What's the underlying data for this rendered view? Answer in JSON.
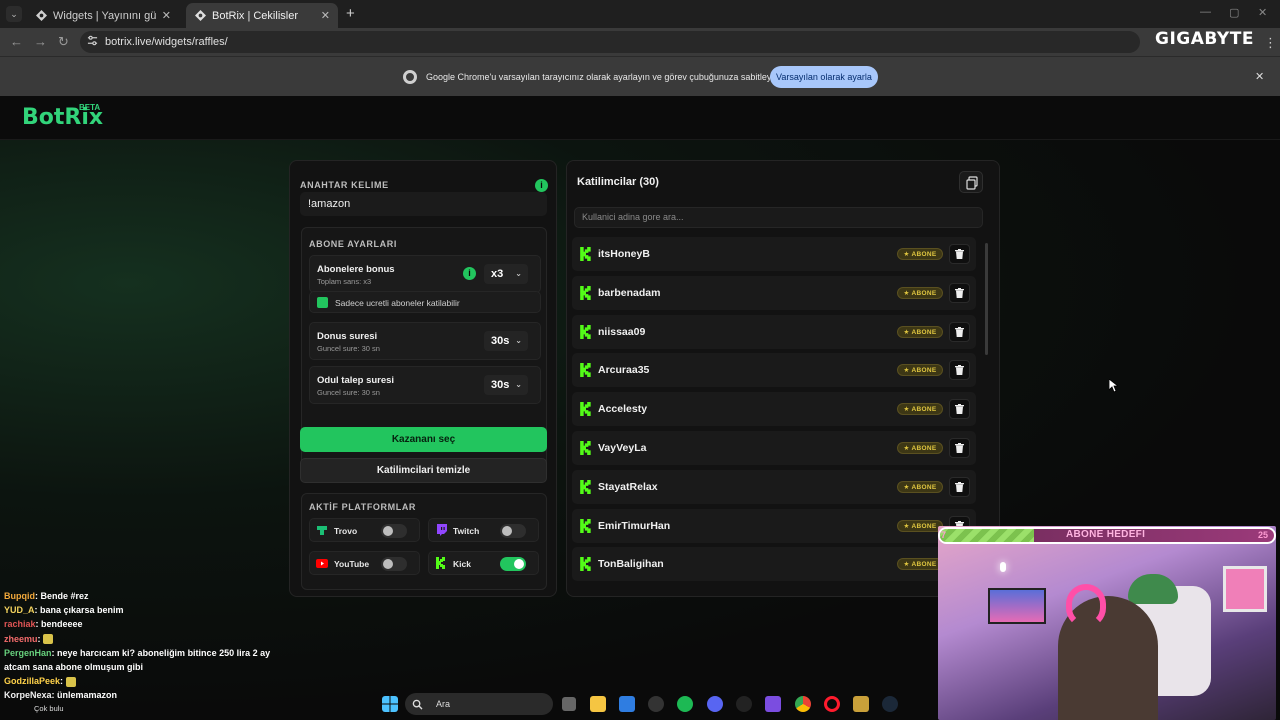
{
  "browser": {
    "tabs": [
      {
        "title": "Widgets | Yayınını güçlendirmek"
      },
      {
        "title": "BotRix | Cekilisler",
        "active": true
      }
    ],
    "url": "botrix.live/widgets/raffles/",
    "brand_overlay": "GIGABYTE",
    "infobar": {
      "message": "Google Chrome'u varsayılan tarayıcınız olarak ayarlayın ve görev çubuğunuza sabitleyin",
      "button": "Varsayılan olarak ayarla"
    }
  },
  "site": {
    "logo": "BotRix",
    "beta": "BETA",
    "accent": "#22c55e"
  },
  "settings": {
    "keyword_label": "ANAHTAR KELIME",
    "keyword_value": "!amazon",
    "subscriber_section": "ABONE AYARLARI",
    "bonus": {
      "title": "Abonelere bonus",
      "subtitle": "Toplam sans: x3",
      "value": "x3"
    },
    "paid_only": {
      "label": "Sadece ucretli aboneler katilabilir",
      "checked": true
    },
    "duration": {
      "title": "Donus suresi",
      "subtitle": "Guncel sure: 30 sn",
      "value": "30s"
    },
    "claim": {
      "title": "Odul talep suresi",
      "subtitle": "Guncel sure: 30 sn",
      "value": "30s"
    },
    "pick_winner": "Kazananı seç",
    "clear_participants": "Katilimcilari temizle",
    "platforms_label": "AKTİF PLATFORMLAR",
    "platforms": [
      {
        "name": "Trovo",
        "enabled": false,
        "icon": "trovo-icon",
        "color": "#1bbf75"
      },
      {
        "name": "Twitch",
        "enabled": false,
        "icon": "twitch-icon",
        "color": "#9146ff"
      },
      {
        "name": "YouTube",
        "enabled": false,
        "icon": "youtube-icon",
        "color": "#ff0000"
      },
      {
        "name": "Kick",
        "enabled": true,
        "icon": "kick-icon",
        "color": "#53fc18"
      }
    ]
  },
  "participants": {
    "title": "Katilimcilar (30)",
    "search_placeholder": "Kullanici adina gore ara...",
    "badge": "ABONE",
    "items": [
      {
        "name": "itsHoneyB"
      },
      {
        "name": "barbenadam"
      },
      {
        "name": "niissaa09"
      },
      {
        "name": "Arcuraa35"
      },
      {
        "name": "Accelesty"
      },
      {
        "name": "VayVeyLa"
      },
      {
        "name": "StayatRelax"
      },
      {
        "name": "EmirTimurHan"
      },
      {
        "name": "TonBaligihan"
      }
    ]
  },
  "stream_overlay": {
    "chat": [
      {
        "user": "Bupqid",
        "text": "Bende #rez"
      },
      {
        "user": "YUD_A",
        "text": "bana çıkarsa benim"
      },
      {
        "user": "rachiak",
        "text": "bendeeee"
      },
      {
        "user": "zheemu",
        "text": ""
      },
      {
        "user": "PergenHan",
        "text": "neye harcıcam ki? aboneliğim bitince 250 lira 2 ay atcam sana abone olmuşum gibi"
      },
      {
        "user": "GodzillaPeek",
        "text": ""
      },
      {
        "user": "KorpeNexa",
        "text": "ünlemamazon"
      }
    ],
    "goal": {
      "title": "ABONE HEDEFI",
      "current": "7",
      "target": "25"
    }
  },
  "taskbar": {
    "search_placeholder": "Ara",
    "weather": "Çok bulu"
  }
}
